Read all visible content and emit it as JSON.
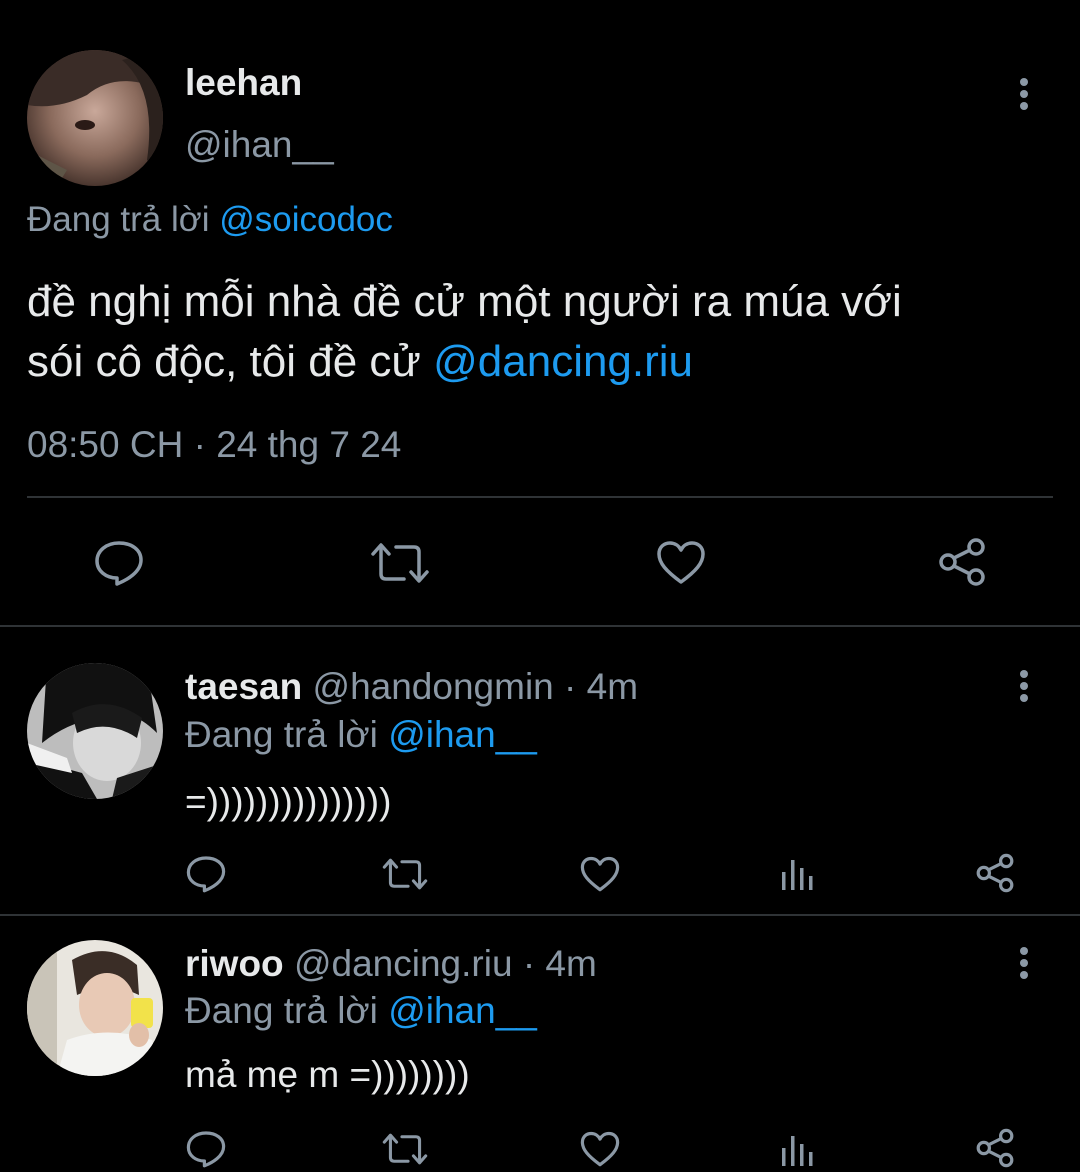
{
  "main_tweet": {
    "display_name": "leehan",
    "handle": "@ihan__",
    "reply_prefix": "Đang trả lời",
    "reply_to": "@soicodoc",
    "text_line1": "đề nghị mỗi nhà đề cử một người ra múa với",
    "text_line2_plain": "sói cô độc, tôi đề cử ",
    "text_line2_mention": "@dancing.riu",
    "timestamp": "08:50 CH · 24 thg 7 24"
  },
  "replies": [
    {
      "display_name": "taesan",
      "handle": "@handongmin",
      "sep": "·",
      "time": "4m",
      "reply_prefix": "Đang trả lời",
      "reply_to": "@ihan__",
      "text": "=)))))))))))))))"
    },
    {
      "display_name": "riwoo",
      "handle": "@dancing.riu",
      "sep": "·",
      "time": "4m",
      "reply_prefix": "Đang trả lời",
      "reply_to": "@ihan__",
      "text": "mả mẹ m =))))))))"
    }
  ],
  "colors": {
    "background": "#000000",
    "text": "#e7e9ea",
    "secondary": "#8b98a5",
    "link": "#1d9bf0",
    "divider": "#2f3336"
  },
  "icons": [
    "more-icon",
    "reply-icon",
    "retweet-icon",
    "like-icon",
    "share-icon",
    "stats-icon"
  ]
}
